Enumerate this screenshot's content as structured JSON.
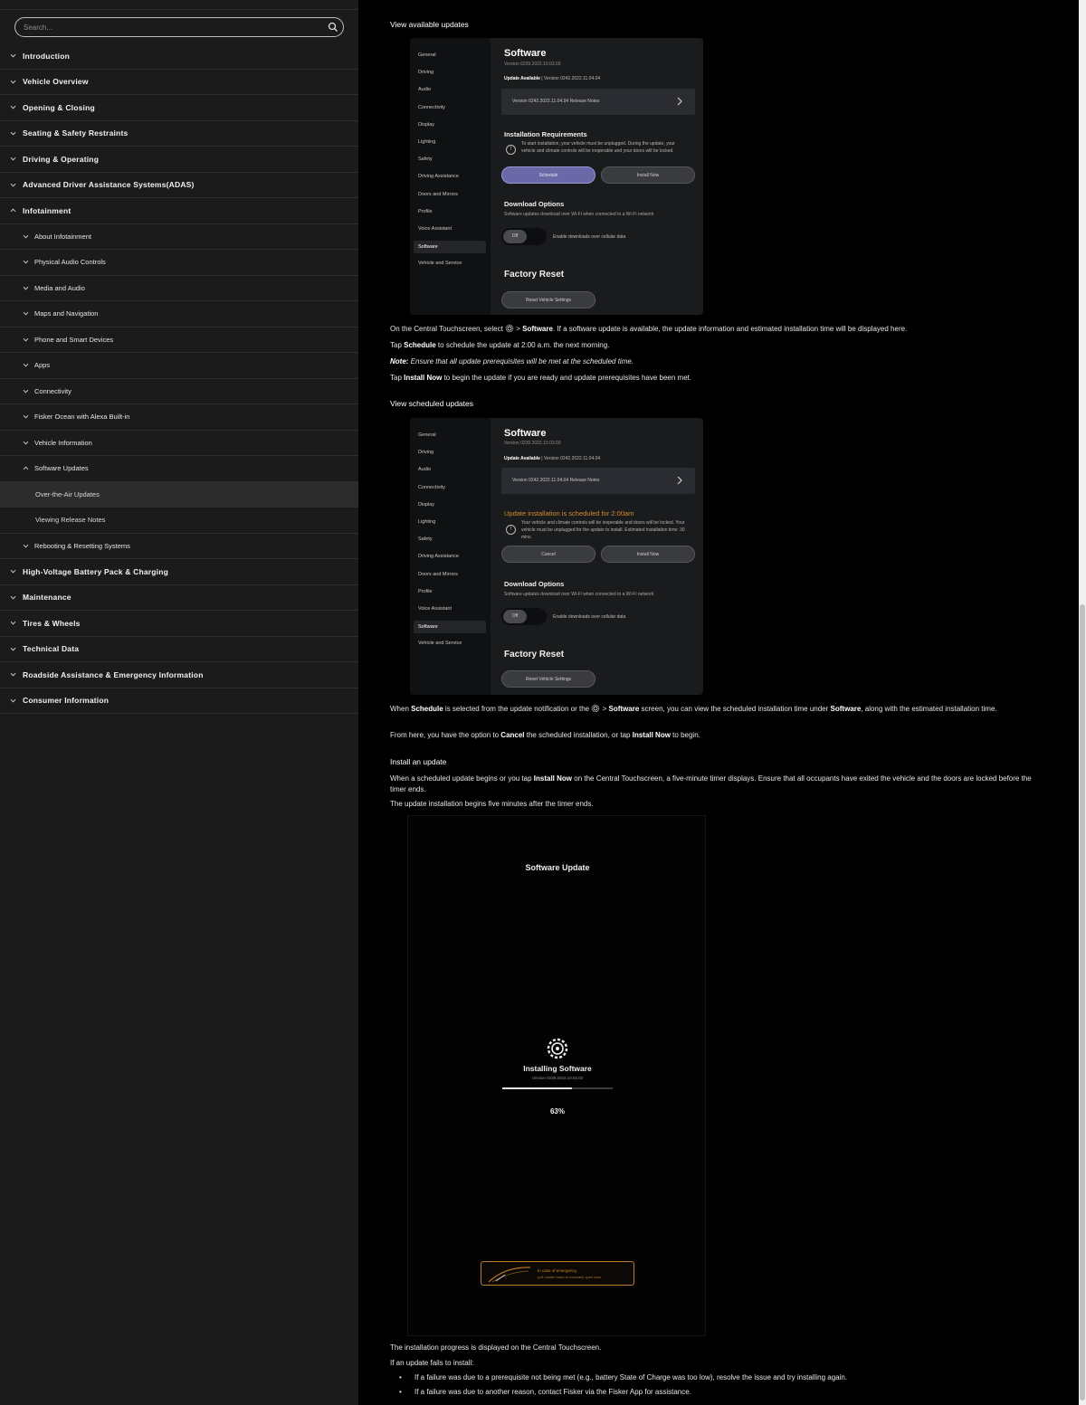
{
  "search": {
    "placeholder": "Search..."
  },
  "sidebar": {
    "items": [
      {
        "label": "Introduction",
        "level": 1,
        "state": "collapsed"
      },
      {
        "label": "Vehicle Overview",
        "level": 1,
        "state": "collapsed"
      },
      {
        "label": "Opening & Closing",
        "level": 1,
        "state": "collapsed"
      },
      {
        "label": "Seating & Safety Restraints",
        "level": 1,
        "state": "collapsed"
      },
      {
        "label": "Driving & Operating",
        "level": 1,
        "state": "collapsed"
      },
      {
        "label": "Advanced Driver Assistance Systems(ADAS)",
        "level": 1,
        "state": "collapsed"
      },
      {
        "label": "Infotainment",
        "level": 1,
        "state": "expanded"
      },
      {
        "label": "About Infotainment",
        "level": 2,
        "state": "collapsed"
      },
      {
        "label": "Physical Audio Controls",
        "level": 2,
        "state": "collapsed"
      },
      {
        "label": "Media and Audio",
        "level": 2,
        "state": "collapsed"
      },
      {
        "label": "Maps and Navigation",
        "level": 2,
        "state": "collapsed"
      },
      {
        "label": "Phone and Smart Devices",
        "level": 2,
        "state": "collapsed"
      },
      {
        "label": "Apps",
        "level": 2,
        "state": "collapsed"
      },
      {
        "label": "Connectivity",
        "level": 2,
        "state": "collapsed"
      },
      {
        "label": "Fisker Ocean with Alexa Built-in",
        "level": 2,
        "state": "collapsed"
      },
      {
        "label": "Vehicle Information",
        "level": 2,
        "state": "collapsed"
      },
      {
        "label": "Software Updates",
        "level": 2,
        "state": "expanded"
      },
      {
        "label": "Over-the-Air Updates",
        "level": 3,
        "state": "active"
      },
      {
        "label": "Viewing Release Notes",
        "level": 3,
        "state": "none"
      },
      {
        "label": "Rebooting & Resetting Systems",
        "level": 2,
        "state": "collapsed"
      },
      {
        "label": "High-Voltage Battery Pack & Charging",
        "level": 1,
        "state": "collapsed"
      },
      {
        "label": "Maintenance",
        "level": 1,
        "state": "collapsed"
      },
      {
        "label": "Tires & Wheels",
        "level": 1,
        "state": "collapsed"
      },
      {
        "label": "Technical Data",
        "level": 1,
        "state": "collapsed"
      },
      {
        "label": "Roadside Assistance & Emergency Information",
        "level": 1,
        "state": "collapsed"
      },
      {
        "label": "Consumer Information",
        "level": 1,
        "state": "collapsed"
      }
    ]
  },
  "content": {
    "heading_available": "View available updates",
    "p1": {
      "a": "On the Central Touchscreen, select ",
      "b": " > ",
      "c": "Software",
      "d": ". If a software update is available, the update information and estimated installation time will be displayed here."
    },
    "p2": {
      "a": "Tap ",
      "b": "Schedule",
      "c": " to schedule the update at 2:00 a.m. the next morning."
    },
    "p3": {
      "a": "Note:",
      "b": " Ensure that all update prerequisites will be met at the scheduled time."
    },
    "p4": {
      "a": "Tap ",
      "b": "Install Now",
      "c": " to begin the update if you are ready and update prerequisites have been met."
    },
    "heading_scheduled": "View scheduled updates",
    "p5": {
      "a": "When ",
      "b": "Schedule",
      "c": " is selected from the update notification or the ",
      "d": " > ",
      "e": "Software",
      "f": " screen, you can view the scheduled installation time under ",
      "g": "Software",
      "h": ", along with the estimated installation time."
    },
    "p6": {
      "a": "From here, you have the option to ",
      "b": "Cancel",
      "c": " the scheduled installation, or tap ",
      "d": "Install Now",
      "e": " to begin."
    },
    "heading_install": "Install an update",
    "p7": {
      "a": "When a scheduled update begins or you tap ",
      "b": "Install Now",
      "c": " on the Central Touchscreen, a five-minute timer displays. Ensure that all occupants have exited the vehicle and the doors are locked before the timer ends."
    },
    "p8": "The update installation begins five minutes after the timer ends.",
    "p9": "The installation progress is displayed on the Central Touchscreen.",
    "p10": "If an update fails to install:",
    "bullets": [
      "If a failure was due to a prerequisite not being met (e.g., battery State of Charge was too low), resolve the issue and try installing again.",
      "If a failure was due to another reason, contact Fisker via the Fisker App for assistance."
    ]
  },
  "shot_menu": [
    "General",
    "Driving",
    "Audio",
    "Connectivity",
    "Display",
    "Lighting",
    "Safety",
    "Driving Assistance",
    "Doors and Mirrors",
    "Profile",
    "Voice Assistant",
    "Software",
    "Vehicle and Service"
  ],
  "shot1": {
    "title": "Software",
    "version": "Version 0239.2022.10.03.03",
    "available_label": "Update Available",
    "available_value": " | Version 0242.2022.11.04.04",
    "notes": "Version 0242.2022.11.04.04 Release Notes",
    "req_title": "Installation Requirements",
    "req_text": "To start installation, your vehicle must be unplugged. During the update, your vehicle and climate controls will be inoperable and your doors will be locked.",
    "btn_left": "Schedule",
    "btn_right": "Install Now",
    "dl_title": "Download Options",
    "dl_desc": "Software updates download over Wi-Fi when connected to a Wi-Fi network",
    "toggle": "Off",
    "toggle_label": "Enable downloads over cellular data",
    "fr_title": "Factory Reset",
    "reset": "Reset Vehicle Settings"
  },
  "shot2": {
    "title": "Software",
    "version": "Version 0239.2022.10.03.03",
    "available_label": "Update Available",
    "available_value": " | Version 0242.2022.11.04.04",
    "notes": "Version 0242.2022.11.04.04 Release Notes",
    "req_title": "Update installation is scheduled for 2:00am",
    "req_text": "Your vehicle and climate controls will be inoperable and doors will be locked. Your vehicle must be unplugged for the update to install. Estimated installation time: 30 mins.",
    "btn_left": "Cancel",
    "btn_right": "Install Now",
    "dl_title": "Download Options",
    "dl_desc": "Software updates download over Wi-Fi when connected to a Wi-Fi network",
    "toggle": "Off",
    "toggle_label": "Enable downloads over cellular data",
    "fr_title": "Factory Reset",
    "reset": "Reset Vehicle Settings"
  },
  "install_shot": {
    "title": "Software Update",
    "installing": "Installing Software",
    "version": "Version 0239.2022.10.03.03",
    "progress_percent": 63,
    "progress_label": "63%",
    "emergency_1": "In case of emergency,",
    "emergency_2": "pull handle twice to manually open door."
  },
  "colors": {
    "sidebar_bg": "#1b1b1c",
    "content_bg": "#000000",
    "accent_purple": "#6b68a8",
    "accent_orange": "#d88b2c"
  }
}
